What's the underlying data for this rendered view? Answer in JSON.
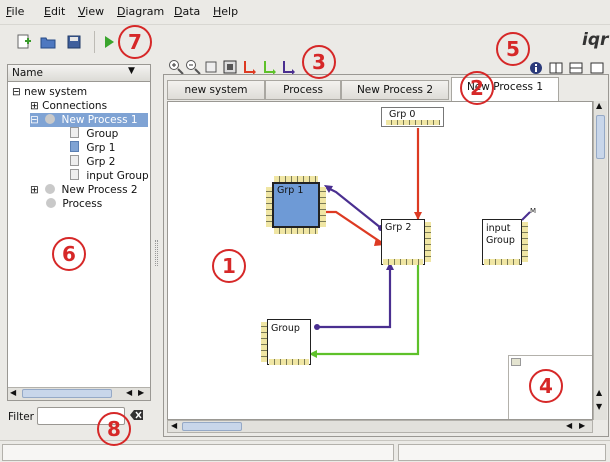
{
  "menu": [
    "File",
    "Edit",
    "View",
    "Diagram",
    "Data",
    "Help"
  ],
  "brand": "iqr",
  "tree": {
    "header": "Name",
    "items": [
      {
        "label": "new system"
      },
      {
        "label": "Connections"
      },
      {
        "label": "New Process 1"
      },
      {
        "label": "Group"
      },
      {
        "label": "Grp 1"
      },
      {
        "label": "Grp 2"
      },
      {
        "label": "input Group"
      },
      {
        "label": "New Process 2"
      },
      {
        "label": "Process"
      }
    ]
  },
  "tabs": [
    "new system",
    "Process",
    "New Process 2",
    "New Process 1"
  ],
  "active_tab_index": 3,
  "diagram": {
    "nodes": [
      "Grp 0",
      "Grp 1",
      "Grp 2",
      "input Group",
      "Group"
    ],
    "connection_colors": {
      "red": "#dd3a22",
      "blue": "#4a2f90",
      "green": "#5ec12a"
    }
  },
  "filter": {
    "label": "Filter",
    "value": ""
  },
  "callouts": [
    "1",
    "2",
    "3",
    "4",
    "5",
    "6",
    "7",
    "8"
  ],
  "colors": {
    "callout": "#d62828",
    "selection": "#7fa3d4",
    "group_fill": "#6e9ad6"
  }
}
